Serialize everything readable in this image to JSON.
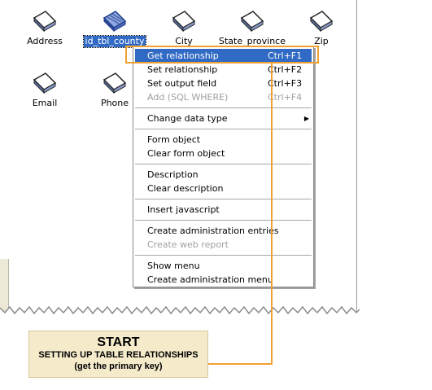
{
  "fields": [
    {
      "name": "Address",
      "selected": false
    },
    {
      "name": "id_tbl_county",
      "selected": true
    },
    {
      "name": "City",
      "selected": false
    },
    {
      "name": "State_province",
      "selected": false
    },
    {
      "name": "Zip",
      "selected": false
    },
    {
      "name": "Email",
      "selected": false
    },
    {
      "name": "Phone",
      "selected": false
    }
  ],
  "menu": {
    "items": [
      {
        "label": "Get relationship",
        "shortcut": "Ctrl+F1",
        "highlighted": true
      },
      {
        "label": "Set relationship",
        "shortcut": "Ctrl+F2"
      },
      {
        "label": "Set output field",
        "shortcut": "Ctrl+F3"
      },
      {
        "label": "Add (SQL WHERE)",
        "shortcut": "Ctrl+F4",
        "disabled": true
      },
      {
        "label": "Change data type",
        "submenu": true
      },
      {
        "label": "Form object"
      },
      {
        "label": "Clear form object"
      },
      {
        "label": "Description"
      },
      {
        "label": "Clear description"
      },
      {
        "label": "Insert javascript"
      },
      {
        "label": "Create administration entries"
      },
      {
        "label": "Create web report",
        "disabled": true
      },
      {
        "label": "Show menu"
      },
      {
        "label": "Create administration menu"
      }
    ]
  },
  "callout": {
    "title": "START",
    "subtitle": "SETTING UP TABLE RELATIONSHIPS",
    "note": "(get the primary key)"
  },
  "colors": {
    "accent": "#f0a030",
    "highlight": "#316ac5",
    "callout_bg": "#f5ebcb"
  },
  "icons": {
    "field": "table-field-icon",
    "submenu": "submenu-arrow-icon"
  }
}
